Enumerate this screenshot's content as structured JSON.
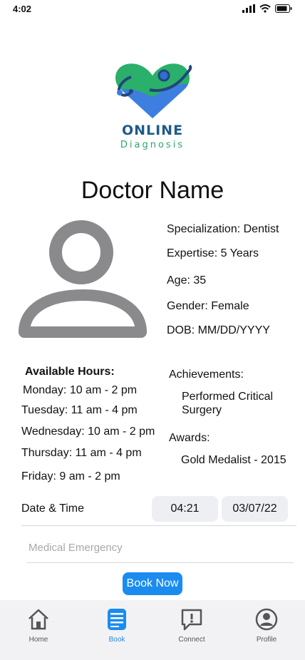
{
  "status": {
    "time": "4:02"
  },
  "logo": {
    "title": "ONLINE",
    "subtitle": "Diagnosis"
  },
  "doctor": {
    "name": "Doctor Name",
    "specialization": "Specialization: Dentist",
    "expertise": "Expertise: 5 Years",
    "age": "Age: 35",
    "gender": "Gender: Female",
    "dob": "DOB: MM/DD/YYYY"
  },
  "hours": {
    "heading": "Available Hours:",
    "items": [
      "Monday: 10 am - 2 pm",
      "Tuesday: 11 am - 4 pm",
      "Wednesday: 10 am - 2 pm",
      "Thursday: 11 am - 4 pm",
      "Friday: 9 am - 2 pm"
    ]
  },
  "achievements": {
    "heading": "Achievements:",
    "line1": "Performed Critical",
    "line2": "Surgery"
  },
  "awards": {
    "heading": "Awards:",
    "item": "Gold Medalist - 2015"
  },
  "booking": {
    "label": "Date & Time",
    "time": "04:21",
    "date": "03/07/22",
    "emergency_placeholder": "Medical Emergency",
    "button": "Book Now"
  },
  "tabs": [
    {
      "label": "Home",
      "icon": "home-icon"
    },
    {
      "label": "Book",
      "icon": "book-icon"
    },
    {
      "label": "Connect",
      "icon": "chat-alert-icon"
    },
    {
      "label": "Profile",
      "icon": "profile-icon"
    }
  ],
  "colors": {
    "accent": "#1a8cf0",
    "logo_blue": "#1e5a8a",
    "logo_green": "#2aa86a",
    "avatar_gray": "#8a8a8c"
  }
}
